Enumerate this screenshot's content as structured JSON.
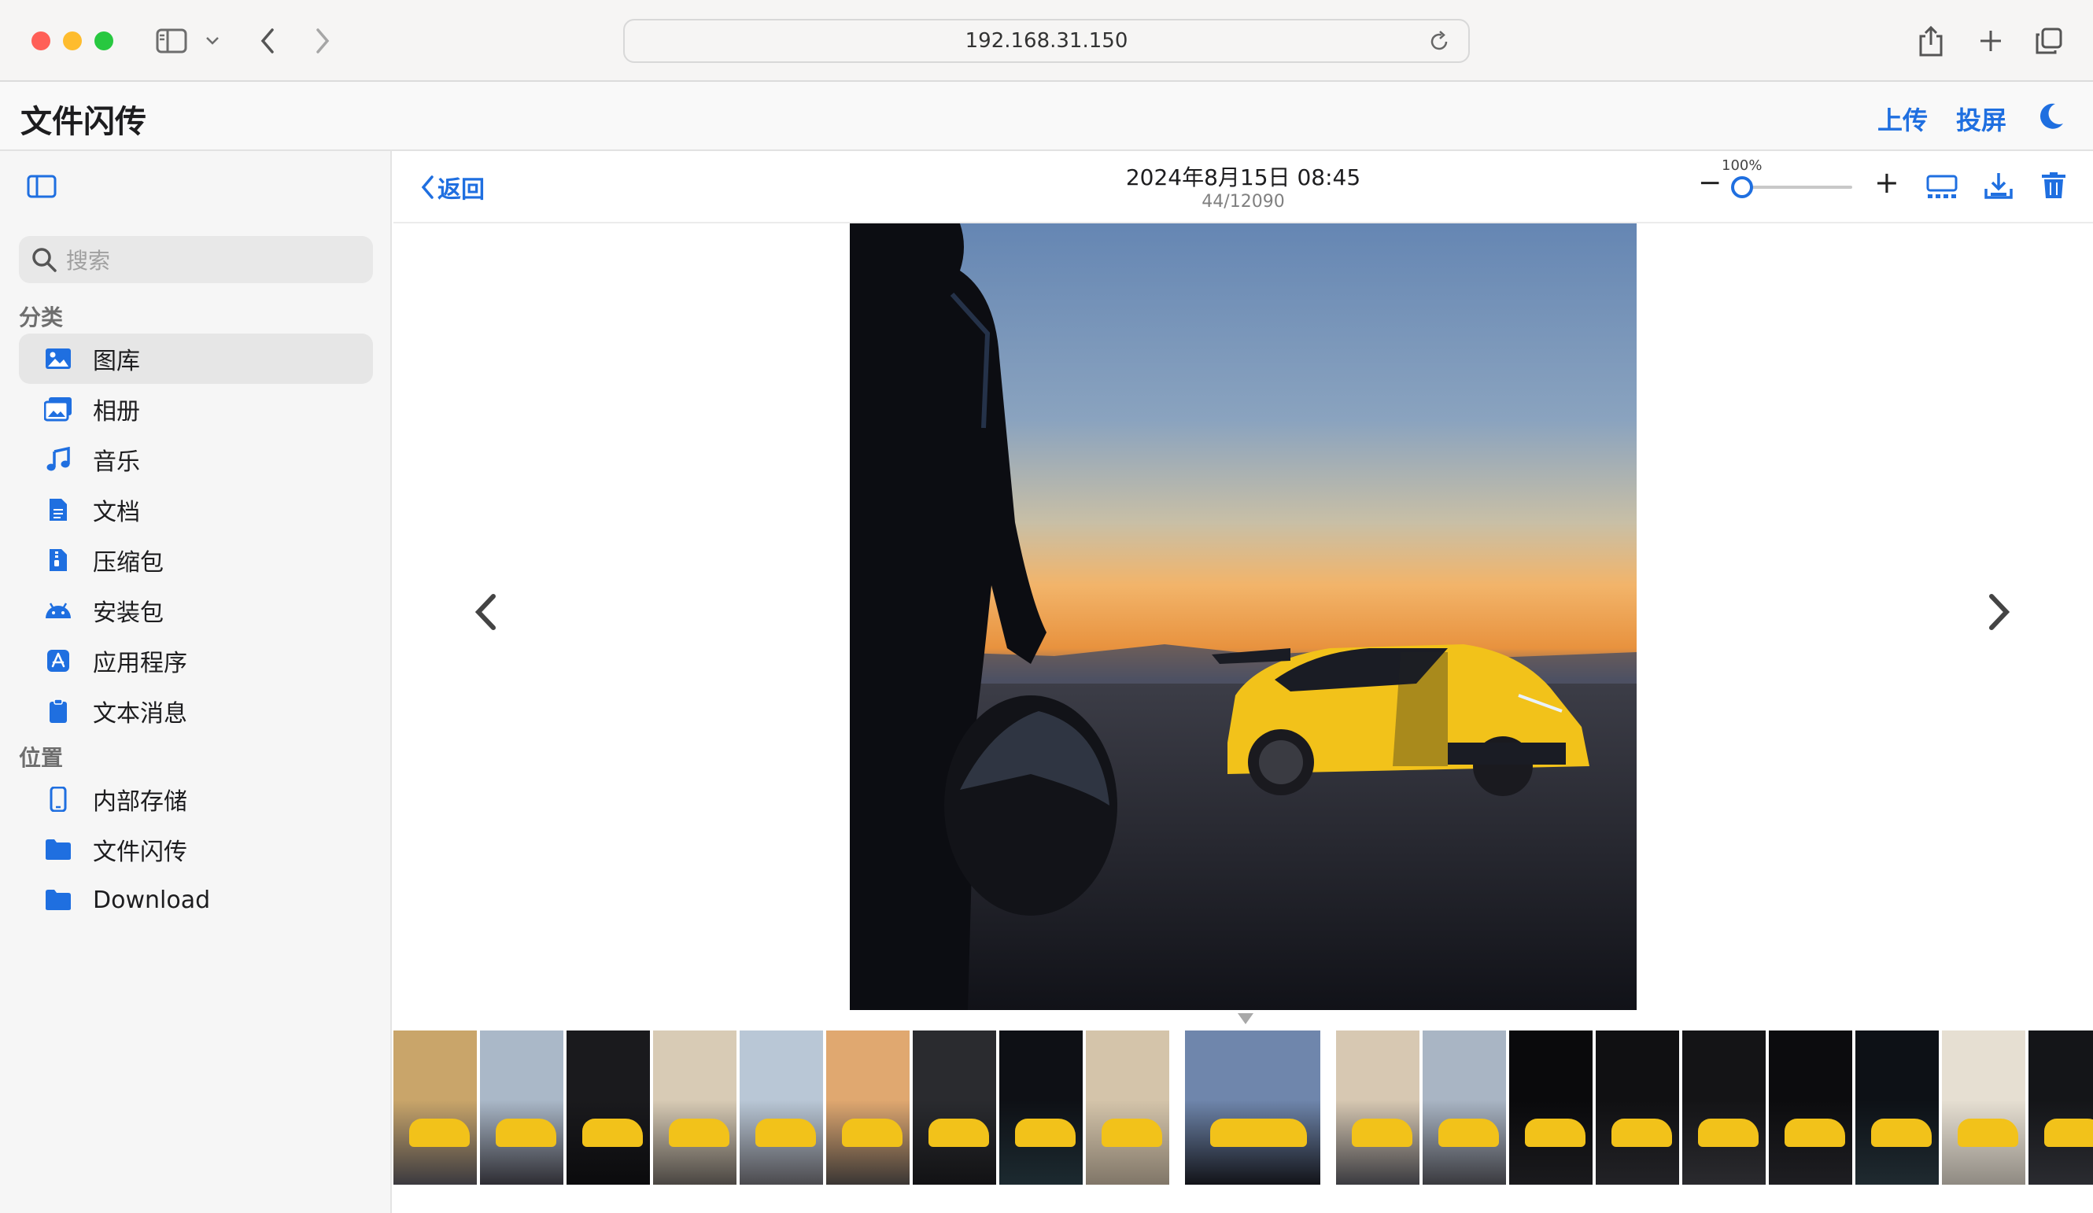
{
  "browser": {
    "url": "192.168.31.150"
  },
  "app": {
    "title": "文件闪传",
    "actions": {
      "upload": "上传",
      "cast": "投屏"
    }
  },
  "sidebar": {
    "search_placeholder": "搜索",
    "sections": {
      "categories": "分类",
      "locations": "位置"
    },
    "categories": [
      {
        "label": "图库",
        "icon": "image-icon"
      },
      {
        "label": "相册",
        "icon": "album-icon"
      },
      {
        "label": "音乐",
        "icon": "music-icon"
      },
      {
        "label": "文档",
        "icon": "document-icon"
      },
      {
        "label": "压缩包",
        "icon": "archive-icon"
      },
      {
        "label": "安装包",
        "icon": "android-icon"
      },
      {
        "label": "应用程序",
        "icon": "app-store-icon"
      },
      {
        "label": "文本消息",
        "icon": "clipboard-icon"
      }
    ],
    "locations": [
      {
        "label": "内部存储",
        "icon": "phone-icon"
      },
      {
        "label": "文件闪传",
        "icon": "folder-icon"
      },
      {
        "label": "Download",
        "icon": "folder-icon"
      }
    ],
    "active_item": "图库"
  },
  "viewer": {
    "back_label": "返回",
    "date": "2024年8月15日 08:45",
    "counter": "44/12090",
    "zoom": "100%",
    "zoom_level": 0.0,
    "thumbnail_count": 19,
    "selected_thumbnail": 10
  },
  "colors": {
    "accent": "#1f6fe0",
    "car_yellow": "#f2c21a"
  }
}
